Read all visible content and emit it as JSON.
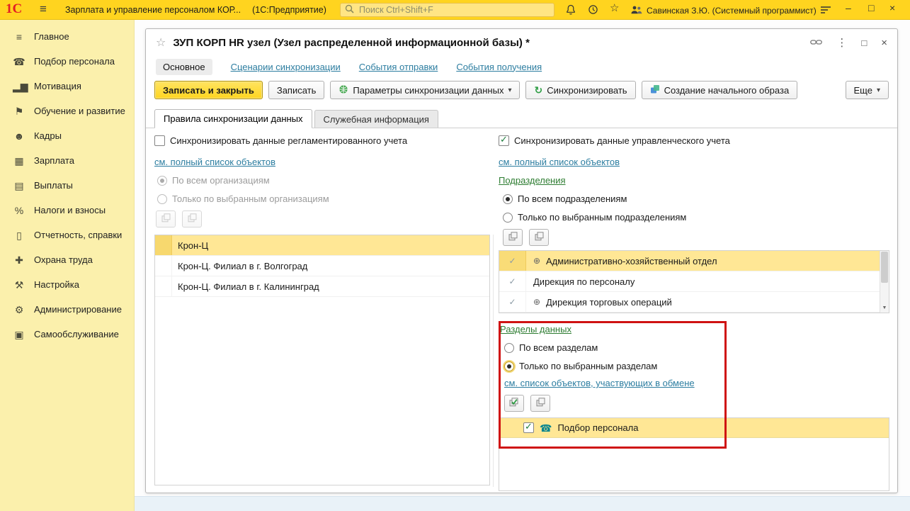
{
  "colors": {
    "brand_yellow": "#FFD41F",
    "sidebar_yellow": "#FBF0AC",
    "selection_yellow": "#FFE795",
    "link_blue": "#2C7DA0",
    "link_green": "#2E7D32",
    "annotation_red": "#CF1212",
    "check_green": "#1C7C3C",
    "phone_teal": "#00838F",
    "logo_red": "#E31E24"
  },
  "icons": {
    "hamburger": "≡",
    "favorite_star": "☆",
    "form_star": "☆",
    "dots_vertical": "⋮",
    "minimize": "–",
    "maximize": "□",
    "close": "×",
    "dropdown": "▾",
    "sync": "↻",
    "expand": "⊕",
    "check": "✓",
    "phone": "☎",
    "scroll_down": "▼"
  },
  "topbar": {
    "logo": "1С",
    "title": "Зарплата и управление персоналом КОР...",
    "platform": "(1С:Предприятие)",
    "search_placeholder": "Поиск Ctrl+Shift+F",
    "user": "Савинская З.Ю. (Системный программист)"
  },
  "sidebar": {
    "items": [
      {
        "label": "Главное",
        "icon": "≡"
      },
      {
        "label": "Подбор персонала",
        "icon": "☎"
      },
      {
        "label": "Мотивация",
        "icon": "▂▆"
      },
      {
        "label": "Обучение и развитие",
        "icon": "⚑"
      },
      {
        "label": "Кадры",
        "icon": "☻"
      },
      {
        "label": "Зарплата",
        "icon": "▦"
      },
      {
        "label": "Выплаты",
        "icon": "▤"
      },
      {
        "label": "Налоги и взносы",
        "icon": "%"
      },
      {
        "label": "Отчетность, справки",
        "icon": "▯"
      },
      {
        "label": "Охрана труда",
        "icon": "✚"
      },
      {
        "label": "Настройка",
        "icon": "⚒"
      },
      {
        "label": "Администрирование",
        "icon": "⚙"
      },
      {
        "label": "Самообслуживание",
        "icon": "▣"
      }
    ]
  },
  "form": {
    "title": "ЗУП КОРП HR узел (Узел распределенной информационной базы) *",
    "nav_tabs": [
      {
        "label": "Основное"
      },
      {
        "label": "Сценарии синхронизации"
      },
      {
        "label": "События отправки"
      },
      {
        "label": "События получения"
      }
    ],
    "toolbar": {
      "save_close": "Записать и закрыть",
      "save": "Записать",
      "sync_params": "Параметры синхронизации данных",
      "synchronize": "Синхронизировать",
      "initial_image": "Создание начального образа",
      "more": "Еще"
    },
    "tabs": [
      {
        "label": "Правила синхронизации данных"
      },
      {
        "label": "Служебная информация"
      }
    ],
    "left_panel": {
      "checkbox_label": "Синхронизировать данные регламентированного учета",
      "link": "см. полный список объектов",
      "radio_all": "По всем организациям",
      "radio_selected": "Только по выбранным организациям",
      "rows": [
        "Крон-Ц",
        "Крон-Ц. Филиал в г. Волгоград",
        "Крон-Ц. Филиал в г. Калининград"
      ]
    },
    "right_panel": {
      "checkbox_label": "Синхронизировать данные управленческого учета",
      "link": "см. полный список объектов",
      "group_link": "Подразделения",
      "radio_all": "По всем подразделениям",
      "radio_selected": "Только по выбранным подразделениям",
      "rows": [
        {
          "label": "Административно-хозяйственный отдел"
        },
        {
          "label": "Дирекция по персоналу"
        },
        {
          "label": "Дирекция торговых операций"
        }
      ]
    },
    "sections": {
      "group_link": "Разделы данных",
      "radio_all": "По всем разделам",
      "radio_selected": "Только по выбранным разделам",
      "link": "см. список объектов, участвующих в обмене",
      "row_label": "Подбор персонала"
    }
  }
}
